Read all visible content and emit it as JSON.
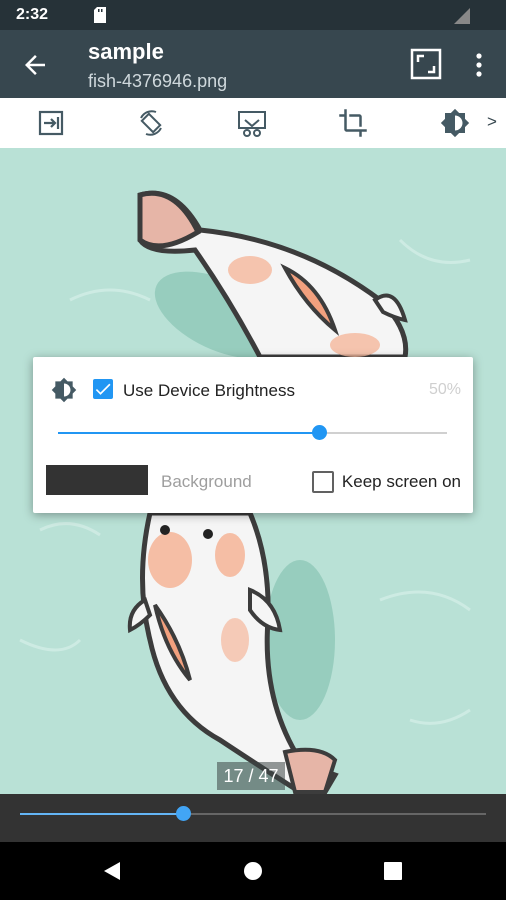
{
  "status_bar": {
    "time": "2:32",
    "icons": [
      "sd-card-icon",
      "signal-icon"
    ]
  },
  "app_bar": {
    "title": "sample",
    "subtitle": "fish-4376946.png",
    "icons": [
      "back-arrow-icon",
      "fullscreen-icon",
      "overflow-menu-icon"
    ]
  },
  "toolbar": {
    "icons": [
      "exit-icon",
      "rotate-icon",
      "slideshow-icon",
      "crop-icon",
      "brightness-icon"
    ],
    "more": ">"
  },
  "viewer": {
    "page_counter": "17 / 47"
  },
  "brightness_dialog": {
    "use_device_brightness_label": "Use Device Brightness",
    "use_device_brightness_checked": true,
    "percent_label": "50%",
    "slider_value": 0.67,
    "background_label": "Background",
    "background_color": "#333333",
    "keep_screen_on_label": "Keep screen on",
    "keep_screen_on_checked": false
  },
  "page_slider": {
    "value": 0.35
  },
  "colors": {
    "status_bar": "#263238",
    "app_bar": "#37474f",
    "accent": "#2196f3",
    "background": "#b9e1d6"
  },
  "nav_bar": {
    "icons": [
      "back-triangle-icon",
      "home-circle-icon",
      "recents-square-icon"
    ]
  }
}
